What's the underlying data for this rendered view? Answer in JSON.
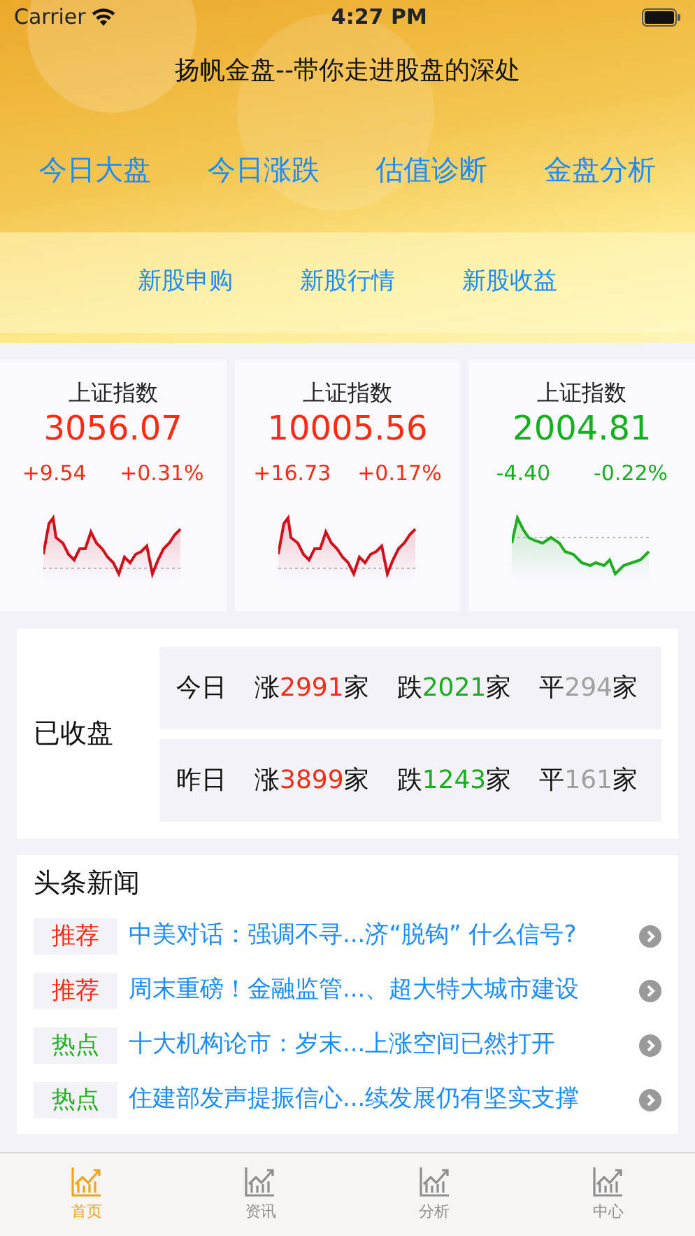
{
  "status_bar": {
    "carrier": "Carrier",
    "time": "4:27 PM"
  },
  "header": {
    "title": "扬帆金盘--带你走进股盘的深处",
    "menu": [
      "今日大盘",
      "今日涨跌",
      "估值诊断",
      "金盘分析"
    ],
    "sub_menu": [
      "新股申购",
      "新股行情",
      "新股收益"
    ]
  },
  "indices": [
    {
      "name": "上证指数",
      "value": "3056.07",
      "change": "+9.54",
      "percent": "+0.31%",
      "kind": "up"
    },
    {
      "name": "上证指数",
      "value": "10005.56",
      "change": "+16.73",
      "percent": "+0.17%",
      "kind": "up"
    },
    {
      "name": "上证指数",
      "value": "2004.81",
      "change": "-4.40",
      "percent": "-0.22%",
      "kind": "down"
    }
  ],
  "market": {
    "status": "已收盘",
    "rows": [
      {
        "label": "今日",
        "items": [
          {
            "prefix": "涨",
            "count": "2991",
            "suffix": "家",
            "kind": "up"
          },
          {
            "prefix": "跌",
            "count": "2021",
            "suffix": "家",
            "kind": "down"
          },
          {
            "prefix": "平",
            "count": "294",
            "suffix": "家",
            "kind": "flat"
          }
        ]
      },
      {
        "label": "昨日",
        "items": [
          {
            "prefix": "涨",
            "count": "3899",
            "suffix": "家",
            "kind": "up"
          },
          {
            "prefix": "跌",
            "count": "1243",
            "suffix": "家",
            "kind": "down"
          },
          {
            "prefix": "平",
            "count": "161",
            "suffix": "家",
            "kind": "flat"
          }
        ]
      }
    ]
  },
  "news": {
    "title": "头条新闻",
    "items": [
      {
        "tag": "推荐",
        "kind": "recommend",
        "title": "中美对话：强调不寻...济“脱钩” 什么信号?"
      },
      {
        "tag": "推荐",
        "kind": "recommend",
        "title": "周末重磅！金融监管...、超大特大城市建设"
      },
      {
        "tag": "热点",
        "kind": "hot",
        "title": "十大机构论市：岁末...上涨空间已然打开"
      },
      {
        "tag": "热点",
        "kind": "hot",
        "title": "住建部发声提振信心...续发展仍有坚实支撑"
      }
    ]
  },
  "tabs": [
    {
      "label": "首页",
      "selected": true
    },
    {
      "label": "资讯",
      "selected": false
    },
    {
      "label": "分析",
      "selected": false
    },
    {
      "label": "中心",
      "selected": false
    }
  ]
}
